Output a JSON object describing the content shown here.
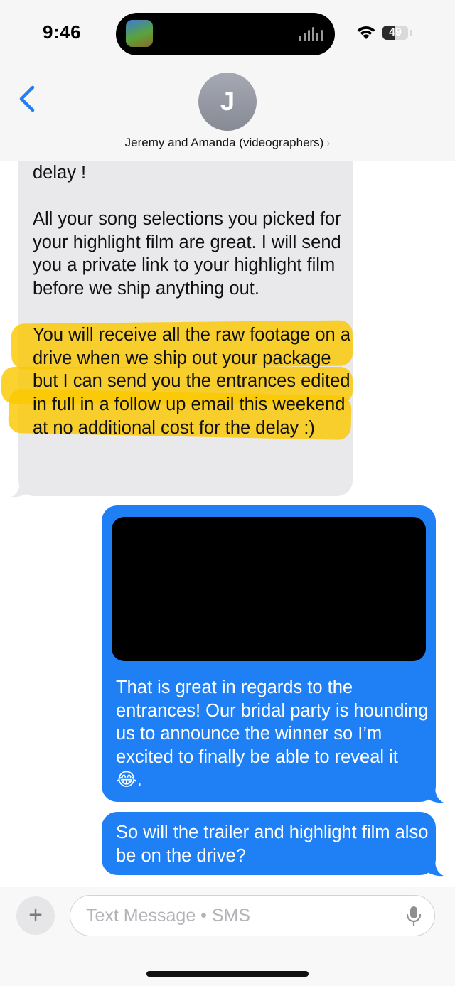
{
  "status_bar": {
    "time": "9:46",
    "battery_level": "49",
    "battery_fraction": 0.49
  },
  "header": {
    "avatar_initial": "J",
    "contact_name": "Jeremy and Amanda (videographers)",
    "chevron_glyph": "›"
  },
  "messages": [
    {
      "direction": "incoming",
      "text": "delay !\n\nAll your song selections you picked for your highlight film are great. I will send you a private link to your highlight film before we ship anything out.\n\nYou will receive all the raw footage on a drive when we ship out your package but I can send you the entrances edited in full in a follow up email this weekend at no additional cost for the delay :)"
    },
    {
      "direction": "outgoing",
      "has_redacted_media": true,
      "text": "That is great in regards to the entrances! Our bridal party is hounding us to announce the winner so I’m excited to finally be able to reveal it 😂."
    },
    {
      "direction": "outgoing",
      "text": "So will the trailer and highlight film also be on the drive?"
    }
  ],
  "composer": {
    "plus_label": "+",
    "placeholder": "Text Message • SMS"
  },
  "colors": {
    "incoming_bubble": "#e9e9eb",
    "outgoing_bubble": "#1f7ff5",
    "accent": "#1f7ff5",
    "highlight": "#f9c900"
  }
}
